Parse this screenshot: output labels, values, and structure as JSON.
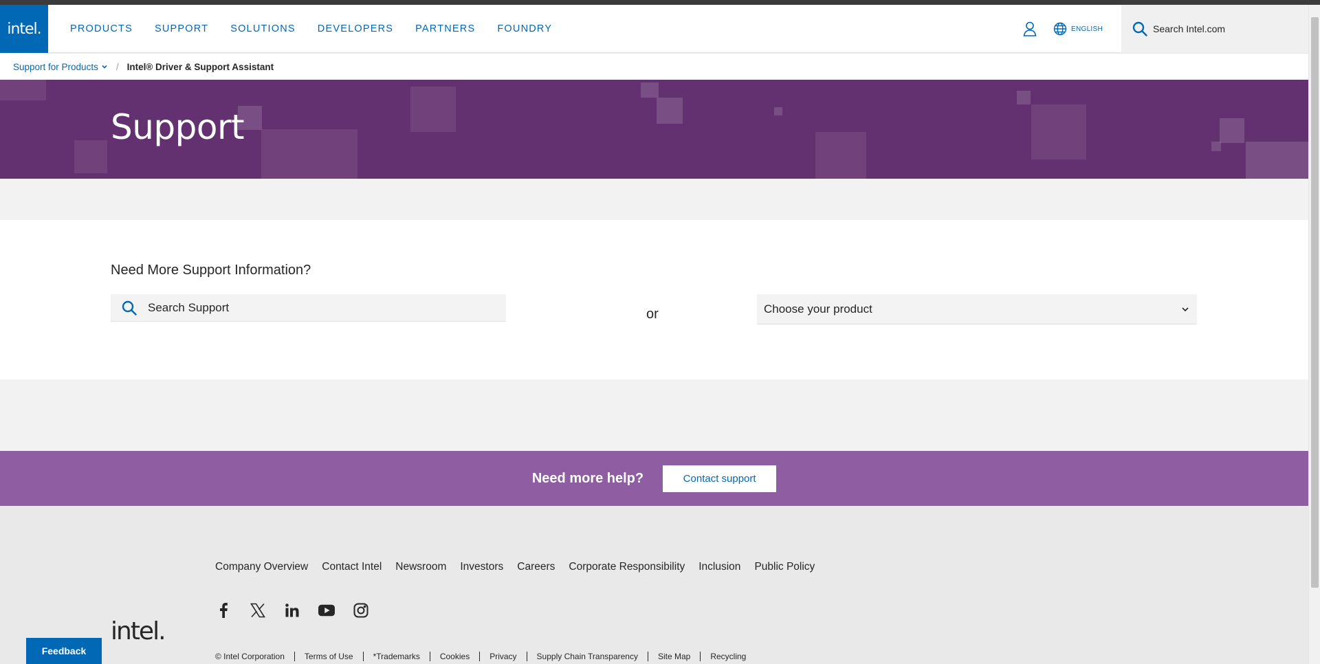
{
  "header": {
    "logo": "intel.",
    "nav": [
      "PRODUCTS",
      "SUPPORT",
      "SOLUTIONS",
      "DEVELOPERS",
      "PARTNERS",
      "FOUNDRY"
    ],
    "language": "ENGLISH",
    "search_placeholder": "Search Intel.com"
  },
  "breadcrumb": {
    "parent": "Support for Products",
    "current": "Intel® Driver & Support Assistant"
  },
  "hero": {
    "title": "Support"
  },
  "support": {
    "heading": "Need More Support Information?",
    "search_placeholder": "Search Support",
    "or": "or",
    "product_select": "Choose your product"
  },
  "help": {
    "question": "Need more help?",
    "button": "Contact support"
  },
  "footer": {
    "links": [
      "Company Overview",
      "Contact Intel",
      "Newsroom",
      "Investors",
      "Careers",
      "Corporate Responsibility",
      "Inclusion",
      "Public Policy"
    ],
    "social": [
      "facebook-icon",
      "x-icon",
      "linkedin-icon",
      "youtube-icon",
      "instagram-icon"
    ],
    "logo": "intel.",
    "legal": [
      "© Intel Corporation",
      "Terms of Use",
      "*Trademarks",
      "Cookies",
      "Privacy",
      "Supply Chain Transparency",
      "Site Map",
      "Recycling"
    ]
  },
  "feedback": "Feedback",
  "colors": {
    "brand_blue": "#0068b5",
    "hero_purple": "#643170",
    "help_purple": "#8f5da2"
  }
}
